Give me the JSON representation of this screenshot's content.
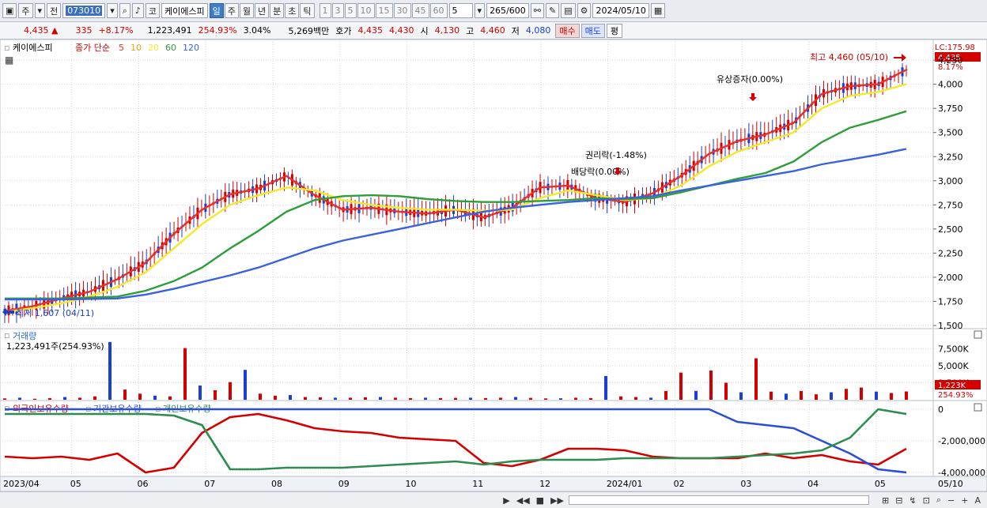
{
  "toolbar": {
    "period_select": "주",
    "prev_label": "전",
    "code": "073010",
    "sound_label": "◀",
    "market_label": "코",
    "stock_name": "케이에스피",
    "period_buttons": [
      "일",
      "주",
      "월",
      "년",
      "분",
      "초",
      "틱"
    ],
    "minute_buttons": [
      "1",
      "3",
      "5",
      "10",
      "15",
      "30",
      "45",
      "60"
    ],
    "custom_value": "5",
    "count": "265",
    "count_max": "/600",
    "date": "2024/05/10"
  },
  "quote": {
    "price": "4,435 ▲",
    "change": "335",
    "rate": "+8.17%",
    "volume": "1,223,491",
    "vol_ratio": "254.93%",
    "turnover": "3.04%",
    "amount": "5,269백만",
    "bid_label": "호가",
    "ask_price": "4,435",
    "bid_price": "4,430",
    "open_label": "시",
    "open": "4,130",
    "high_label": "고",
    "high": "4,460",
    "low_label": "저",
    "low": "4,080",
    "buy_label": "매수",
    "sell_label": "매도",
    "eval_label": "평"
  },
  "price_panel": {
    "stock_name": "케이에스피",
    "ma_label": "종가 단순",
    "ma_periods": [
      "5",
      "10",
      "20",
      "60",
      "120"
    ],
    "ma_colors": [
      "#e8302b",
      "#f0a020",
      "#f5e92a",
      "#2e9e3a",
      "#3a62e0"
    ],
    "lc_label": "LC:175.98",
    "last_price": "4,435",
    "last_rate": "8.17%",
    "y_ticks": [
      "4,250",
      "4,000",
      "3,750",
      "3,500",
      "3,250",
      "3,000",
      "2,750",
      "2,500",
      "2,250",
      "2,000",
      "1,750",
      "1,500"
    ],
    "annotations": [
      {
        "text": "최고 4,460 (05/10)",
        "color": "#d40000"
      },
      {
        "text": "최저 1,607 (04/11)",
        "color": "#1b3fd0"
      },
      {
        "text": "유상증자(0.00%)",
        "color": "#000"
      },
      {
        "text": "권리락(-1.48%)",
        "color": "#000"
      },
      {
        "text": "배당락(0.00%)",
        "color": "#000"
      }
    ]
  },
  "volume_panel": {
    "title": "거래량",
    "value": "1,223,491주(254.93%)",
    "y_ticks": [
      "7,500K",
      "5,000K",
      "2,500K"
    ],
    "last_value": "1,223K",
    "last_rate": "254.93%"
  },
  "holding_panel": {
    "legend": [
      {
        "name": "외국인보유수량",
        "color": "#d40000"
      },
      {
        "name": "기관보유수량",
        "color": "#2a4ed8"
      },
      {
        "name": "개인보유수량",
        "color": "#2e8c4e"
      }
    ],
    "y_ticks": [
      "0",
      "-2,000,000",
      "-4,000,000"
    ]
  },
  "x_axis": {
    "labels": [
      "2023/04",
      "05",
      "06",
      "07",
      "08",
      "09",
      "10",
      "11",
      "12",
      "2024/01",
      "02",
      "03",
      "04",
      "05"
    ],
    "last_label": "05/10"
  },
  "status": {
    "icons": [
      "play-icon",
      "rewind-icon",
      "stop-icon",
      "fast-forward-icon",
      "zoom-icon",
      "minus-icon",
      "plus-icon"
    ],
    "font_label": "A"
  },
  "chart_data": [
    {
      "type": "line",
      "name": "price-moving-averages",
      "ylim": [
        1500,
        4300
      ],
      "series": [
        {
          "name": "5",
          "color": "#e8302b",
          "values": [
            1650,
            1700,
            1780,
            1850,
            1980,
            2150,
            2450,
            2700,
            2860,
            2920,
            3050,
            2850,
            2700,
            2720,
            2680,
            2660,
            2700,
            2620,
            2720,
            2930,
            2950,
            2820,
            2780,
            2870,
            3050,
            3280,
            3410,
            3480,
            3600,
            3900,
            3980,
            4000,
            4150
          ]
        },
        {
          "name": "20",
          "color": "#f5e92a",
          "values": [
            1640,
            1680,
            1730,
            1800,
            1900,
            2050,
            2300,
            2550,
            2750,
            2850,
            2930,
            2900,
            2800,
            2750,
            2720,
            2700,
            2700,
            2690,
            2700,
            2820,
            2900,
            2850,
            2800,
            2820,
            2950,
            3150,
            3300,
            3400,
            3500,
            3750,
            3880,
            3920,
            4000
          ]
        },
        {
          "name": "60",
          "color": "#2e9e3a",
          "values": [
            1780,
            1780,
            1780,
            1790,
            1800,
            1860,
            1960,
            2100,
            2300,
            2480,
            2680,
            2800,
            2840,
            2850,
            2840,
            2810,
            2790,
            2780,
            2780,
            2790,
            2800,
            2820,
            2810,
            2820,
            2880,
            2950,
            3020,
            3080,
            3200,
            3400,
            3550,
            3630,
            3720
          ]
        },
        {
          "name": "120",
          "color": "#3a62e0",
          "values": [
            1770,
            1770,
            1770,
            1775,
            1780,
            1820,
            1880,
            1950,
            2020,
            2100,
            2200,
            2300,
            2380,
            2440,
            2500,
            2560,
            2620,
            2680,
            2720,
            2750,
            2780,
            2800,
            2820,
            2840,
            2900,
            2950,
            3000,
            3050,
            3100,
            3170,
            3220,
            3270,
            3330
          ]
        }
      ]
    },
    {
      "type": "bar",
      "name": "volume",
      "ylim": [
        0,
        10000
      ],
      "values": [
        200,
        300,
        150,
        250,
        400,
        300,
        500,
        8500,
        1500,
        900,
        600,
        500,
        7600,
        2100,
        1400,
        2600,
        4400,
        900,
        600,
        700,
        400,
        350,
        300,
        300,
        350,
        400,
        300,
        250,
        300,
        250,
        280,
        300,
        250,
        300,
        400,
        280,
        200,
        220,
        300,
        250,
        3500,
        500,
        400,
        300,
        1300,
        4000,
        1300,
        4300,
        2500,
        1100,
        6100,
        1200,
        900,
        1300,
        800,
        1100,
        1600,
        1800,
        1200,
        1000,
        1223
      ]
    },
    {
      "type": "line",
      "name": "holdings",
      "ylim": [
        -4200000,
        300000
      ],
      "series": [
        {
          "name": "외국인보유수량",
          "color": "#d40000",
          "values": [
            -3000000,
            -3100000,
            -3000000,
            -3200000,
            -2800000,
            -4000000,
            -3700000,
            -1500000,
            -500000,
            -300000,
            -700000,
            -1200000,
            -1400000,
            -1500000,
            -1800000,
            -1900000,
            -2000000,
            -3400000,
            -3600000,
            -3200000,
            -2500000,
            -2500000,
            -2600000,
            -3000000,
            -3100000,
            -3100000,
            -3100000,
            -2800000,
            -3100000,
            -2900000,
            -3300000,
            -3500000,
            -2500000
          ]
        },
        {
          "name": "기관보유수량",
          "color": "#2a4ed8",
          "values": [
            0,
            0,
            0,
            0,
            0,
            0,
            0,
            0,
            0,
            0,
            0,
            0,
            0,
            0,
            0,
            0,
            0,
            0,
            0,
            0,
            0,
            0,
            0,
            0,
            0,
            0,
            -800000,
            -1000000,
            -1200000,
            -2000000,
            -2800000,
            -3800000,
            -4000000
          ]
        },
        {
          "name": "개인보유수량",
          "color": "#2e8c4e",
          "values": [
            -300000,
            -300000,
            -300000,
            -300000,
            -300000,
            -300000,
            -400000,
            -1000000,
            -3800000,
            -3800000,
            -3700000,
            -3700000,
            -3700000,
            -3600000,
            -3500000,
            -3400000,
            -3300000,
            -3500000,
            -3300000,
            -3200000,
            -3200000,
            -3200000,
            -3100000,
            -3100000,
            -3100000,
            -3100000,
            -3000000,
            -2900000,
            -2800000,
            -2600000,
            -1800000,
            0,
            -300000
          ]
        }
      ]
    }
  ]
}
